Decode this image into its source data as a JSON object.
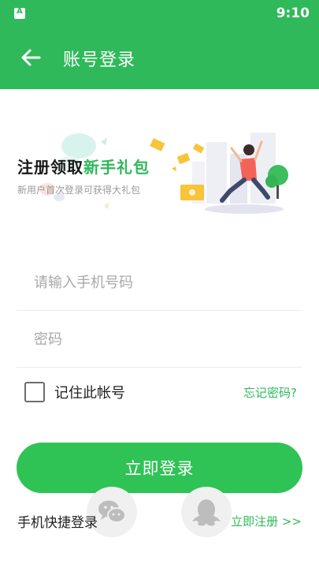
{
  "status_bar": {
    "time": "9:10"
  },
  "header": {
    "title": "账号登录"
  },
  "banner": {
    "title_main": "注册领取",
    "title_highlight": "新手礼包",
    "subtitle": "新用户首次登录可获得大礼包"
  },
  "form": {
    "phone_placeholder": "请输入手机号码",
    "phone_value": "",
    "password_placeholder": "密码",
    "password_value": "",
    "remember_label": "记住此帐号",
    "remember_checked": false,
    "forgot_label": "忘记密码?",
    "login_label": "立即登录"
  },
  "footer": {
    "quick_login_label": "手机快捷登录",
    "register_label": "立即注册 >>",
    "social_icons": [
      "wechat-icon",
      "qq-icon"
    ]
  },
  "colors": {
    "primary": "#2fb95a",
    "button": "#2fc356",
    "placeholder": "#a8a8a8"
  }
}
